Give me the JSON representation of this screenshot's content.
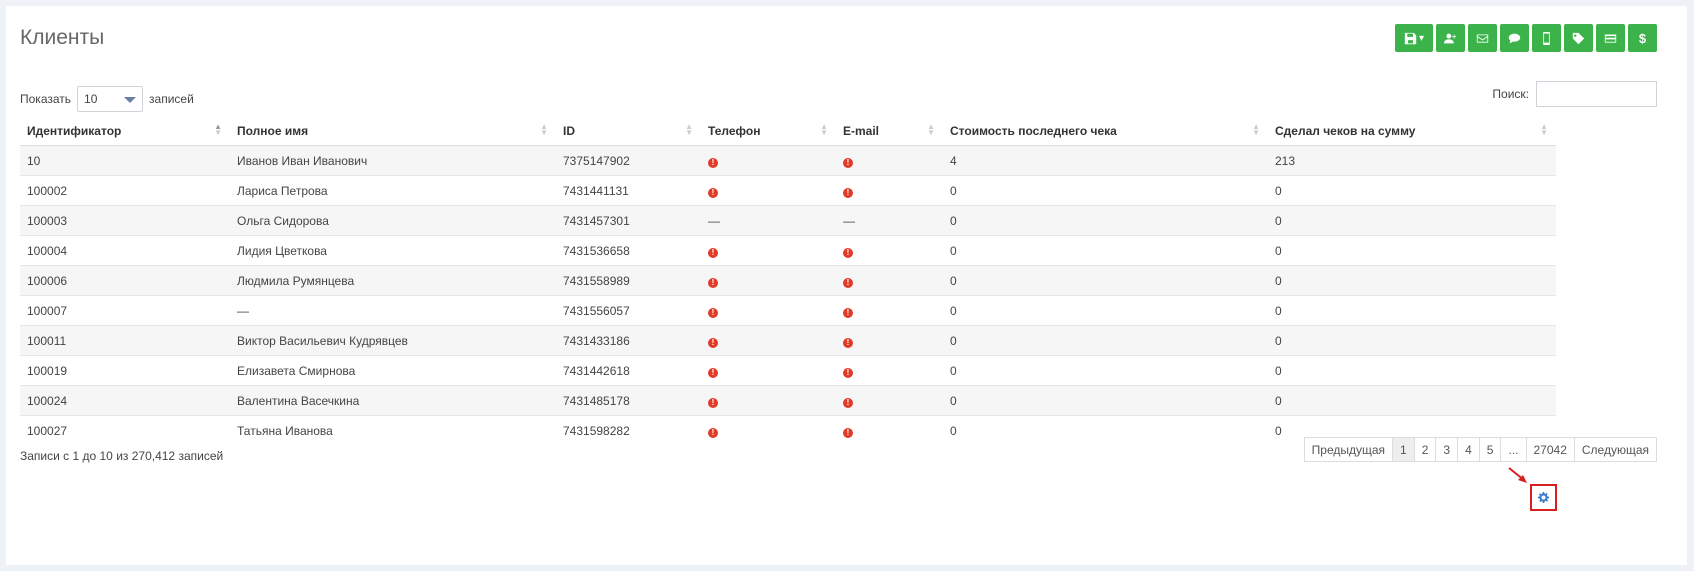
{
  "page": {
    "title": "Клиенты"
  },
  "toolbar": {
    "buttons": [
      {
        "name": "save-dropdown-button",
        "icon": "save-icon",
        "caret": "▾"
      },
      {
        "name": "add-user-button",
        "icon": "user-plus-icon"
      },
      {
        "name": "email-button",
        "icon": "envelope-icon"
      },
      {
        "name": "sms-button",
        "icon": "comment-icon"
      },
      {
        "name": "mobile-button",
        "icon": "mobile-icon"
      },
      {
        "name": "tag-button",
        "icon": "tag-icon"
      },
      {
        "name": "card-button",
        "icon": "credit-card-icon"
      },
      {
        "name": "money-button",
        "icon": "dollar-icon",
        "glyph": "$"
      }
    ],
    "color": "#3cb34a"
  },
  "length": {
    "label_before": "Показать",
    "value": "10",
    "label_after": "записей"
  },
  "search": {
    "label": "Поиск:",
    "value": ""
  },
  "table": {
    "columns": [
      "Идентификатор",
      "Полное имя",
      "ID",
      "Телефон",
      "E-mail",
      "Стоимость последнего чека",
      "Сделал чеков на сумму"
    ],
    "rows": [
      {
        "id": "10",
        "name": "Иванов Иван Иванович",
        "ext": "7375147902",
        "phone": "warn",
        "email": "warn",
        "last": "4",
        "total": "213"
      },
      {
        "id": "100002",
        "name": "Лариса Петрова",
        "ext": "7431441131",
        "phone": "warn",
        "email": "warn",
        "last": "0",
        "total": "0"
      },
      {
        "id": "100003",
        "name": "Ольга Сидорова",
        "ext": "7431457301",
        "phone": "—",
        "email": "—",
        "last": "0",
        "total": "0"
      },
      {
        "id": "100004",
        "name": "Лидия Цветкова",
        "ext": "7431536658",
        "phone": "warn",
        "email": "warn",
        "last": "0",
        "total": "0"
      },
      {
        "id": "100006",
        "name": "Людмила Румянцева",
        "ext": "7431558989",
        "phone": "warn",
        "email": "warn",
        "last": "0",
        "total": "0"
      },
      {
        "id": "100007",
        "name": "—",
        "ext": "7431556057",
        "phone": "warn",
        "email": "warn",
        "last": "0",
        "total": "0"
      },
      {
        "id": "100011",
        "name": "Виктор Васильевич Кудрявцев",
        "ext": "7431433186",
        "phone": "warn",
        "email": "warn",
        "last": "0",
        "total": "0"
      },
      {
        "id": "100019",
        "name": "Елизавета Смирнова",
        "ext": "7431442618",
        "phone": "warn",
        "email": "warn",
        "last": "0",
        "total": "0"
      },
      {
        "id": "100024",
        "name": "Валентина Васечкина",
        "ext": "7431485178",
        "phone": "warn",
        "email": "warn",
        "last": "0",
        "total": "0"
      },
      {
        "id": "100027",
        "name": "Татьяна Иванова",
        "ext": "7431598282",
        "phone": "warn",
        "email": "warn",
        "last": "0",
        "total": "0"
      }
    ],
    "warn_glyph": "!"
  },
  "info": "Записи с 1 до 10 из 270,412 записей",
  "pagination": {
    "prev": "Предыдущая",
    "pages": [
      "1",
      "2",
      "3",
      "4",
      "5",
      "...",
      "27042"
    ],
    "active": "1",
    "next": "Следующая"
  },
  "settings": {
    "icon": "gear-icon"
  }
}
